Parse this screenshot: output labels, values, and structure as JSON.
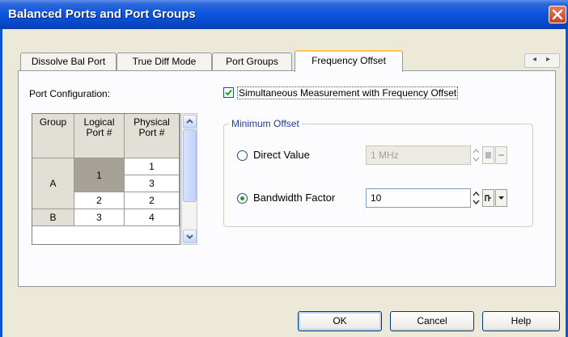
{
  "window": {
    "title": "Balanced Ports and Port Groups"
  },
  "tabs": [
    {
      "label": "Dissolve Bal Port"
    },
    {
      "label": "True Diff Mode"
    },
    {
      "label": "Port Groups"
    },
    {
      "label": "Frequency Offset"
    }
  ],
  "tab_scroll": {
    "left_symbol": "◂",
    "right_symbol": "▸"
  },
  "port_config": {
    "label": "Port Configuration:",
    "headers": {
      "group": "Group",
      "logical": "Logical Port #",
      "physical": "Physical Port #"
    },
    "rows": [
      {
        "group": "A",
        "logical": "1",
        "physical": [
          "1",
          "3"
        ]
      },
      {
        "group": "",
        "logical": "2",
        "physical": [
          "2"
        ]
      },
      {
        "group": "B",
        "logical": "3",
        "physical": [
          "4"
        ]
      }
    ]
  },
  "simultaneous": {
    "label": "Simultaneous Measurement with Frequency Offset",
    "checked": true
  },
  "minimum_offset": {
    "legend": "Minimum Offset",
    "direct_value": {
      "label": "Direct Value",
      "value": "1 MHz",
      "selected": false
    },
    "bandwidth_factor": {
      "label": "Bandwidth Factor",
      "value": "10",
      "selected": true
    }
  },
  "buttons": {
    "ok": "OK",
    "cancel": "Cancel",
    "help": "Help"
  },
  "colors": {
    "title_bar": "#0a54e0",
    "active_tab_accent": "#ffc83c",
    "radio_dot": "#21a121",
    "check_mark": "#21a121"
  }
}
